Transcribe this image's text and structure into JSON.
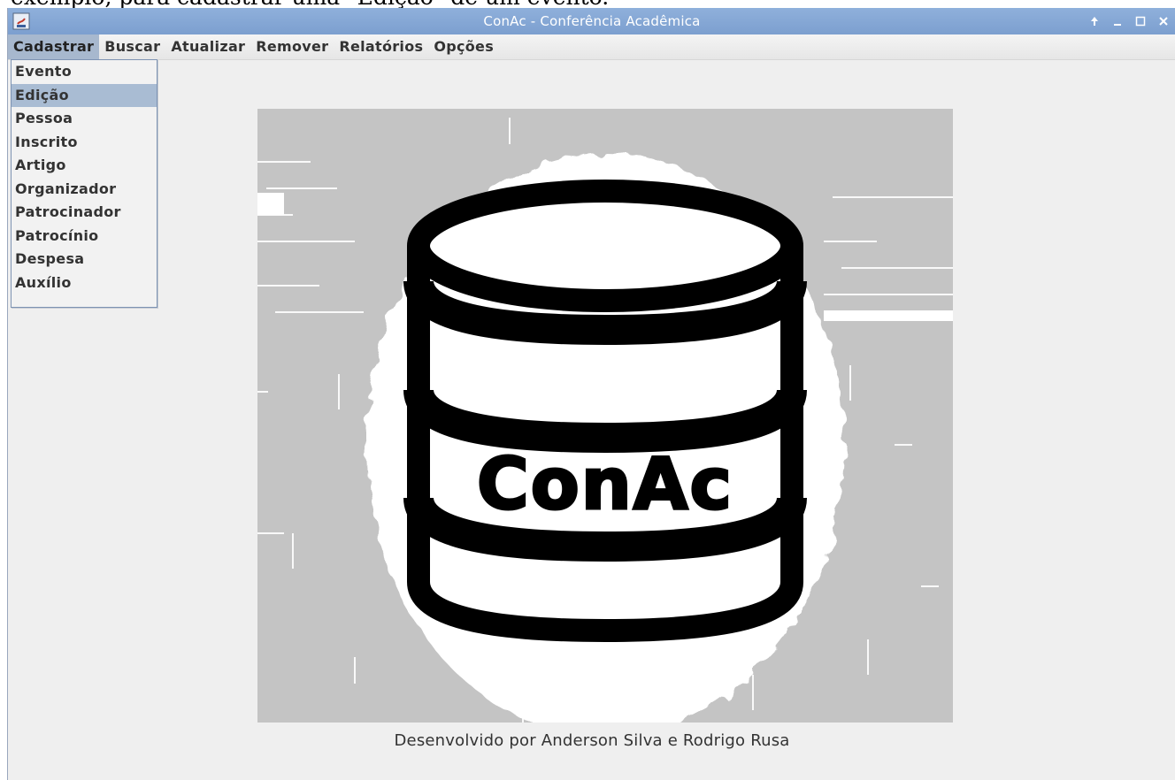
{
  "caption_fragment": "exemplo, para cadastrar uma \"Edição\" de um evento.",
  "window": {
    "title": "ConAc - Conferência Acadêmica",
    "controls": [
      "up-arrow-icon",
      "minimize-icon",
      "maximize-icon",
      "close-icon"
    ]
  },
  "menubar": {
    "items": [
      {
        "label": "Cadastrar",
        "active": true
      },
      {
        "label": "Buscar"
      },
      {
        "label": "Atualizar"
      },
      {
        "label": "Remover"
      },
      {
        "label": "Relatórios"
      },
      {
        "label": "Opções"
      }
    ]
  },
  "dropdown": {
    "items": [
      {
        "label": "Evento"
      },
      {
        "label": "Edição",
        "selected": true
      },
      {
        "label": "Pessoa"
      },
      {
        "label": "Inscrito"
      },
      {
        "label": "Artigo"
      },
      {
        "label": "Organizador"
      },
      {
        "label": "Patrocinador"
      },
      {
        "label": "Patrocínio"
      },
      {
        "label": "Despesa"
      },
      {
        "label": "Auxílio"
      }
    ]
  },
  "logo": {
    "text": "ConAc",
    "icon": "database-cylinder-icon"
  },
  "footer": "Desenvolvido por Anderson Silva e Rodrigo Rusa",
  "colors": {
    "titlebar": "#8aabd8",
    "menu_highlight": "#a9bcd3",
    "window_bg": "#efefef",
    "logo_bg": "#c4c4c4"
  }
}
